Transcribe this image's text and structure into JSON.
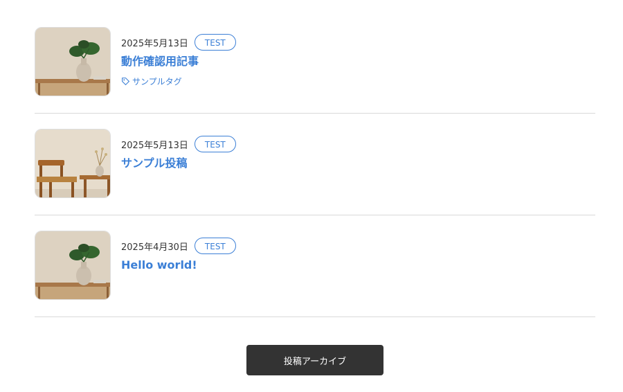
{
  "posts": [
    {
      "date": "2025年5月13日",
      "category": "TEST",
      "title": "動作確認用記事",
      "tag": "サンプルタグ",
      "image": "monstera-vase-photo"
    },
    {
      "date": "2025年5月13日",
      "category": "TEST",
      "title": "サンプル投稿",
      "image": "wooden-chair-photo"
    },
    {
      "date": "2025年4月30日",
      "category": "TEST",
      "title": "Hello world!",
      "image": "monstera-vase-photo"
    }
  ],
  "archive_button": "投稿アーカイブ",
  "colors": {
    "accent": "#3b7fd6",
    "button_bg": "#333333",
    "divider": "#d9d9d9"
  },
  "icons": {
    "tag": "tag-icon"
  }
}
